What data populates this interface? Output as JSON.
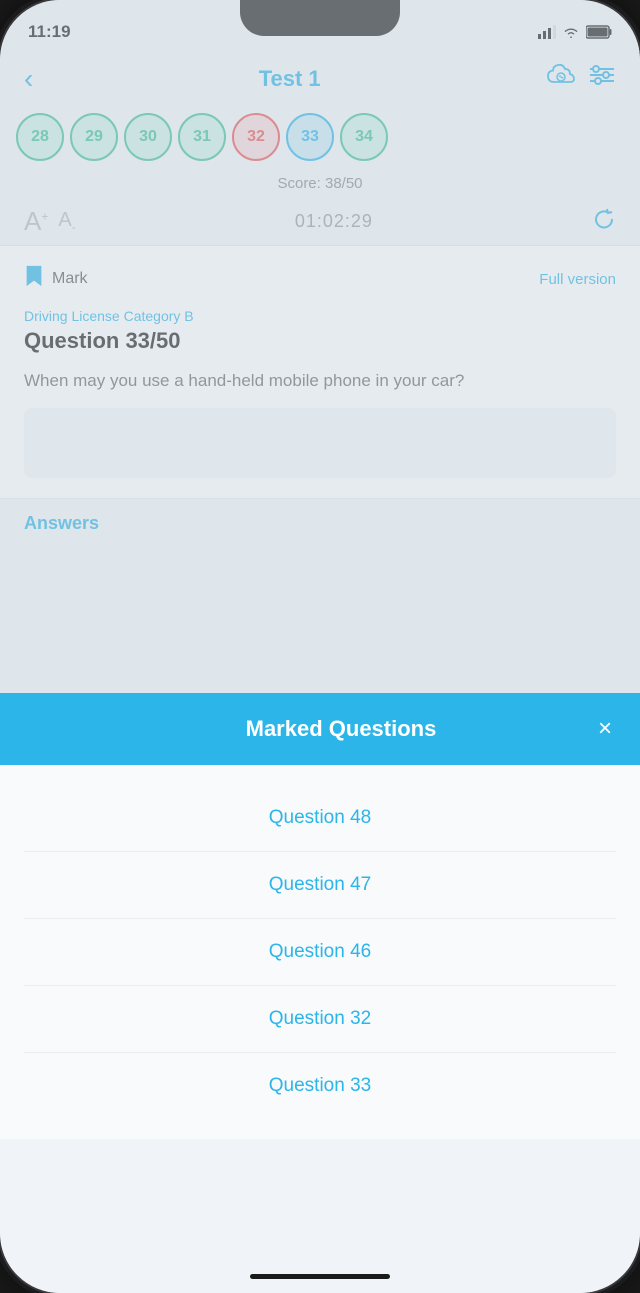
{
  "statusBar": {
    "time": "11:19",
    "batteryIcon": "battery-icon",
    "wifiIcon": "wifi-icon",
    "signalIcon": "signal-icon"
  },
  "header": {
    "backLabel": "‹",
    "title": "Test 1",
    "cloudIconLabel": "cloud-icon",
    "filterIconLabel": "filter-icon"
  },
  "questionNumbers": [
    {
      "num": "28",
      "state": "green"
    },
    {
      "num": "29",
      "state": "green"
    },
    {
      "num": "30",
      "state": "green"
    },
    {
      "num": "31",
      "state": "green"
    },
    {
      "num": "32",
      "state": "red"
    },
    {
      "num": "33",
      "state": "active"
    },
    {
      "num": "34",
      "state": "green"
    }
  ],
  "score": {
    "label": "Score: 38/50"
  },
  "controls": {
    "fontUpLabel": "A",
    "fontDownLabel": "A",
    "timer": "01:02:29",
    "refreshLabel": "↺"
  },
  "question": {
    "markLabel": "Mark",
    "fullVersionLabel": "Full version",
    "categoryLabel": "Driving License Category B",
    "questionTitle": "Question 33/50",
    "questionText": "When may you use a hand-held mobile phone in your car?"
  },
  "answersLabel": "Answers",
  "modal": {
    "title": "Marked Questions",
    "closeLabel": "×",
    "items": [
      {
        "label": "Question 48"
      },
      {
        "label": "Question 47"
      },
      {
        "label": "Question 46"
      },
      {
        "label": "Question 32"
      },
      {
        "label": "Question 33"
      }
    ]
  }
}
